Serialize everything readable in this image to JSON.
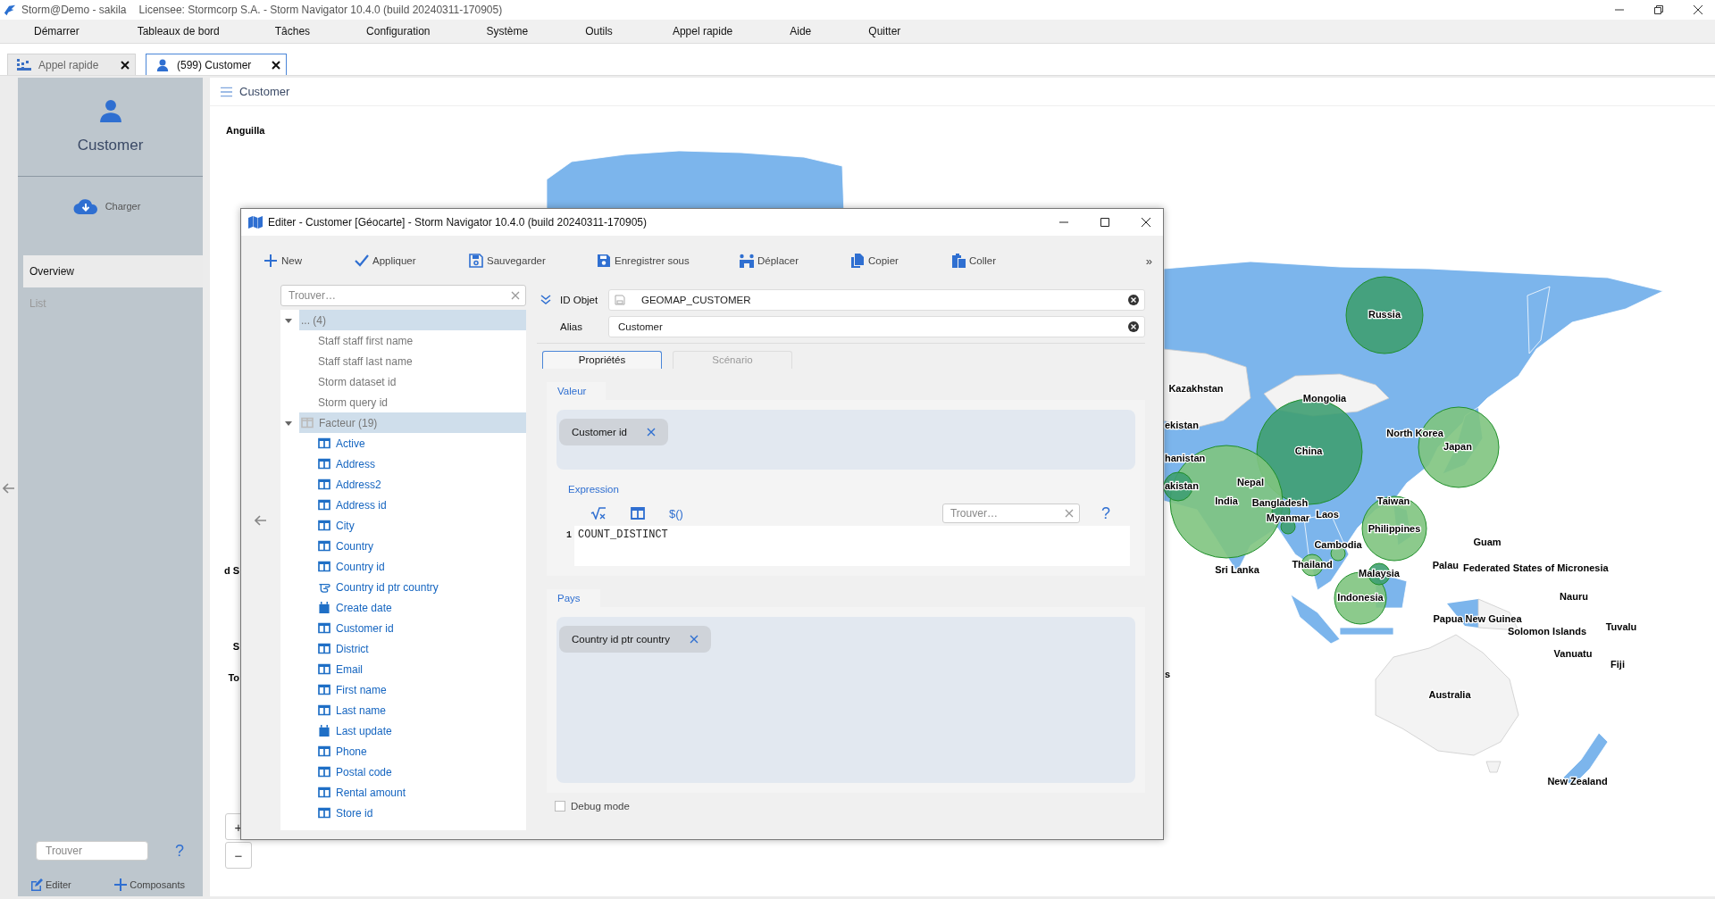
{
  "window": {
    "title": "Storm@Demo - sakila",
    "license": "Licensee: Stormcorp S.A. -  Storm Navigator 10.4.0 (build 20240311-170905)"
  },
  "menu": [
    "Démarrer",
    "Tableaux de bord",
    "Tâches",
    "Configuration",
    "Système",
    "Outils",
    "Appel rapide",
    "Aide",
    "Quitter"
  ],
  "tabs": [
    {
      "label": "Appel rapide",
      "kind": "dashboard",
      "selected": false
    },
    {
      "label": "(599) Customer",
      "kind": "person",
      "selected": true
    }
  ],
  "sidebar": {
    "title": "Customer",
    "load_button": "Charger",
    "items": [
      {
        "label": "Overview",
        "selected": true
      },
      {
        "label": "List",
        "selected": false
      }
    ],
    "search": {
      "placeholder": "Trouver"
    },
    "help": "?",
    "footer": [
      {
        "label": "Editer",
        "kind": "edit"
      },
      {
        "label": "Composants",
        "kind": "add"
      }
    ]
  },
  "panel": {
    "title": "Customer"
  },
  "map": {
    "labels": [
      "Anguilla",
      "Russia",
      "Kazakhstan",
      "Mongolia",
      "ekistan",
      "North Korea",
      "Japan",
      "China",
      "hanistan",
      "Nepal",
      "akistan",
      "India",
      "Bangladesh",
      "Taiwan",
      "Myanmar",
      "Laos",
      "Philippines",
      "Cambodia",
      "Guam",
      "d S",
      "Sri Lanka",
      "Thailand",
      "Malaysia",
      "Palau",
      "Federated States of Micronesia",
      "Indonesia",
      "Nauru",
      "Papua New Guinea",
      "Tuvalu",
      "Solomon Islands",
      "S",
      "Vanuatu",
      "Fiji",
      "To",
      "s",
      "Australia",
      "New Zealand"
    ],
    "bubbles": [
      {
        "color": "#3f9f72"
      },
      {
        "color": "#3f9f72"
      },
      {
        "color": "#7fc47f"
      },
      {
        "color": "#7fc47f"
      },
      {
        "color": "#7fc47f"
      },
      {
        "color": "#7fc47f"
      },
      {
        "color": "#3f9f72"
      },
      {
        "color": "#3f9f72"
      },
      {
        "color": "#3f9f72"
      },
      {
        "color": "#7fc47f"
      },
      {
        "color": "#7fc47f"
      },
      {
        "color": "#3f9f72"
      }
    ],
    "zoom": [
      "+",
      "−"
    ]
  },
  "dialog": {
    "title": "Editer - Customer [Géocarte] -  Storm Navigator 10.4.0 (build 20240311-170905)",
    "toolbar": [
      {
        "label": "New",
        "kind": "new"
      },
      {
        "label": "Appliquer",
        "kind": "apply"
      },
      {
        "label": "Sauvegarder",
        "kind": "save"
      },
      {
        "label": "Enregistrer sous",
        "kind": "saveas"
      },
      {
        "label": "Déplacer",
        "kind": "move"
      },
      {
        "label": "Copier",
        "kind": "copy"
      },
      {
        "label": "Coller",
        "kind": "paste"
      }
    ],
    "more": "»",
    "search": {
      "placeholder": "Trouver…"
    },
    "tree": [
      {
        "label": "... (4)",
        "kind": "group",
        "expanded": true,
        "children": [
          {
            "label": "Staff staff first name",
            "kind": "plain"
          },
          {
            "label": "Staff staff last name",
            "kind": "plain"
          },
          {
            "label": "Storm dataset id",
            "kind": "plain"
          },
          {
            "label": "Storm query id",
            "kind": "plain"
          }
        ]
      },
      {
        "label": "Facteur (19)",
        "kind": "table",
        "expanded": true,
        "children": [
          {
            "label": "Active",
            "kind": "column"
          },
          {
            "label": "Address",
            "kind": "column"
          },
          {
            "label": "Address2",
            "kind": "column"
          },
          {
            "label": "Address id",
            "kind": "column"
          },
          {
            "label": "City",
            "kind": "column"
          },
          {
            "label": "Country",
            "kind": "column"
          },
          {
            "label": "Country id",
            "kind": "column"
          },
          {
            "label": "Country id ptr country",
            "kind": "link"
          },
          {
            "label": "Create date",
            "kind": "date"
          },
          {
            "label": "Customer id",
            "kind": "column"
          },
          {
            "label": "District",
            "kind": "column"
          },
          {
            "label": "Email",
            "kind": "column"
          },
          {
            "label": "First name",
            "kind": "column"
          },
          {
            "label": "Last name",
            "kind": "column"
          },
          {
            "label": "Last update",
            "kind": "date"
          },
          {
            "label": "Phone",
            "kind": "column"
          },
          {
            "label": "Postal code",
            "kind": "column"
          },
          {
            "label": "Rental amount",
            "kind": "column"
          },
          {
            "label": "Store id",
            "kind": "column"
          }
        ]
      }
    ],
    "id_field": {
      "label": "ID Objet",
      "value": "GEOMAP_CUSTOMER"
    },
    "alias_field": {
      "label": "Alias",
      "value": "Customer"
    },
    "tabs": [
      {
        "label": "Propriétés",
        "selected": true
      },
      {
        "label": "Scénario",
        "selected": false
      }
    ],
    "value_section": {
      "title": "Valeur",
      "chips": [
        "Customer id"
      ],
      "expression": {
        "title": "Expression",
        "variable_button": "$()",
        "search": {
          "placeholder": "Trouver…"
        },
        "help": "?",
        "lines": [
          {
            "number": "1",
            "code": "COUNT_DISTINCT"
          }
        ]
      }
    },
    "country_section": {
      "title": "Pays",
      "chips": [
        "Country id ptr country"
      ]
    },
    "debug": {
      "label": "Debug mode",
      "checked": false
    }
  }
}
